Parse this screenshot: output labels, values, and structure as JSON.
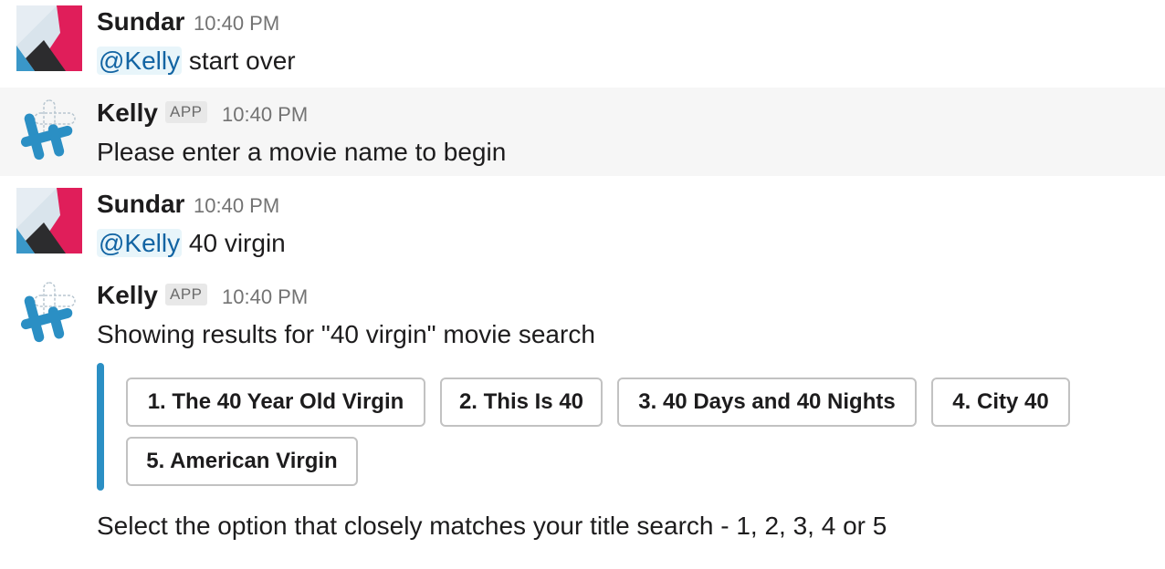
{
  "messages": [
    {
      "author": "Sundar",
      "time": "10:40 PM",
      "mention": "@Kelly",
      "text": " start over",
      "avatar_icon": "user-avatar-icon"
    },
    {
      "author": "Kelly",
      "badge": "APP",
      "time": "10:40 PM",
      "text": "Please enter a movie name to begin",
      "avatar_icon": "slack-app-avatar-icon"
    },
    {
      "author": "Sundar",
      "time": "10:40 PM",
      "mention": "@Kelly",
      "text": " 40 virgin",
      "avatar_icon": "user-avatar-icon"
    },
    {
      "author": "Kelly",
      "badge": "APP",
      "time": "10:40 PM",
      "text": "Showing results for \"40 virgin\" movie search",
      "options": [
        "1. The 40 Year Old Virgin",
        "2. This Is 40",
        "3. 40 Days and 40 Nights",
        "4. City 40",
        "5. American Virgin"
      ],
      "footer": "Select the option that closely matches your title search - 1, 2, 3, 4 or 5",
      "avatar_icon": "slack-app-avatar-icon"
    }
  ],
  "colors": {
    "mention_bg": "#e8f5fa",
    "mention_fg": "#1264a3",
    "attachment_bar": "#2b8fc4",
    "highlight_row": "#f6f6f6"
  }
}
